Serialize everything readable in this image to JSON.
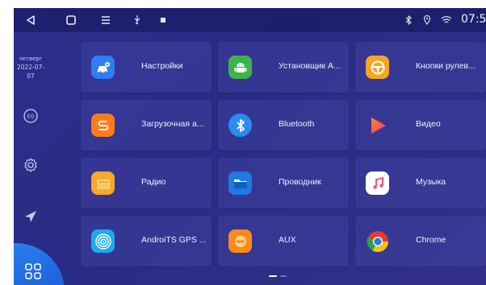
{
  "status_bar": {
    "time": "07:5",
    "icons": [
      "back-icon",
      "home-icon",
      "menu-icon",
      "usb-icon",
      "notification-icon",
      "bluetooth-status-icon",
      "location-icon",
      "wifi-icon"
    ]
  },
  "sidebar": {
    "weekday": "четверг",
    "date": "2022-07-07",
    "icons": [
      "eq-icon",
      "settings-icon",
      "navigation-icon",
      "apps-grid-icon"
    ]
  },
  "apps": [
    {
      "label": "Настройки",
      "icon": "settings-car-icon",
      "color": "#2f7df4"
    },
    {
      "label": "Установщик А...",
      "icon": "android-icon",
      "color": "#3fb34a"
    },
    {
      "label": "Кнопки рулев...",
      "icon": "steering-wheel-icon",
      "color": "#f5a623"
    },
    {
      "label": "Загрузочная а...",
      "icon": "bootanim-icon",
      "color": "#ff7a1a"
    },
    {
      "label": "Bluetooth",
      "icon": "bluetooth-icon",
      "color": "#2a8cf0"
    },
    {
      "label": "Видео",
      "icon": "video-play-icon",
      "color": "#ff3c5a"
    },
    {
      "label": "Радио",
      "icon": "radio-icon",
      "color": "#f7a928"
    },
    {
      "label": "Проводник",
      "icon": "folder-icon",
      "color": "#1e7be0"
    },
    {
      "label": "Музыка",
      "icon": "music-icon",
      "color": "#ff4f70"
    },
    {
      "label": "AndroiTS GPS ...",
      "icon": "gps-icon",
      "color": "#1ea9f0"
    },
    {
      "label": "AUX",
      "icon": "aux-icon",
      "color": "#ff8a1a"
    },
    {
      "label": "Chrome",
      "icon": "chrome-icon",
      "color": "#e33b2e"
    }
  ],
  "pager": {
    "pages": 2,
    "current": 1
  }
}
